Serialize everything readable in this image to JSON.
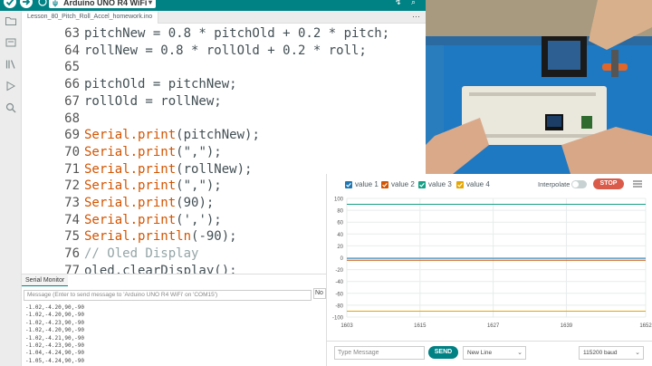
{
  "toolbar": {
    "board_name": "Arduino UNO R4 WiFi",
    "right_icons": [
      "plotter-icon",
      "serial-monitor-icon"
    ]
  },
  "tabs": [
    {
      "label": "Lesson_80_Pitch_Roll_Accel_homework.ino"
    }
  ],
  "editor": {
    "lines": [
      {
        "num": "63",
        "text": "pitchNew = 0.8 * pitchOld + 0.2 * pitch;"
      },
      {
        "num": "64",
        "text": "rollNew = 0.8 * rollOld + 0.2 * roll;"
      },
      {
        "num": "65",
        "text": ""
      },
      {
        "num": "66",
        "text": "pitchOld = pitchNew;"
      },
      {
        "num": "67",
        "text": "rollOld = rollNew;"
      },
      {
        "num": "68",
        "text": ""
      },
      {
        "num": "69",
        "kw": "Serial.print",
        "rest": "(pitchNew);"
      },
      {
        "num": "70",
        "kw": "Serial.print",
        "rest": "(\",\");"
      },
      {
        "num": "71",
        "kw": "Serial.print",
        "rest": "(rollNew);"
      },
      {
        "num": "72",
        "kw": "Serial.print",
        "rest": "(\",\");"
      },
      {
        "num": "73",
        "kw": "Serial.print",
        "rest": "(90);"
      },
      {
        "num": "74",
        "kw": "Serial.print",
        "rest": "(',');"
      },
      {
        "num": "75",
        "kw": "Serial.println",
        "rest": "(-90);"
      },
      {
        "num": "76",
        "comment": "// Oled Display"
      },
      {
        "num": "77",
        "text": "oled.clearDisplay();"
      }
    ]
  },
  "serial_monitor": {
    "tab_label": "Serial Monitor",
    "input_placeholder": "Message (Enter to send message to 'Arduino UNO R4 WiFi' on 'COM15')",
    "right_button": "No",
    "lines": [
      "-1.02,-4.20,90,-90",
      "-1.02,-4.20,90,-90",
      "-1.02,-4.23,90,-90",
      "-1.02,-4.20,90,-90",
      "-1.02,-4.21,90,-90",
      "-1.02,-4.23,90,-90",
      "-1.04,-4.24,90,-90",
      "-1.05,-4.24,90,-90"
    ]
  },
  "plotter": {
    "legend": [
      {
        "label": "value 1",
        "color": "#1f77b4"
      },
      {
        "label": "value 2",
        "color": "#d35400"
      },
      {
        "label": "value 3",
        "color": "#16a085"
      },
      {
        "label": "value 4",
        "color": "#e6a700"
      }
    ],
    "interpolate_label": "Interpolate",
    "stop_label": "STOP",
    "message_placeholder": "Type Message",
    "send_label": "SEND",
    "line_ending": "New Line",
    "baud": "115200 baud"
  },
  "chart_data": {
    "type": "line",
    "y_ticks": [
      100,
      80,
      60,
      40,
      20,
      0,
      -20,
      -40,
      -60,
      -80,
      -100
    ],
    "x_ticks": [
      1603,
      1615,
      1627,
      1639,
      1652
    ],
    "ylim": [
      -100,
      100
    ],
    "xlim": [
      1603,
      1652
    ],
    "grid": true,
    "series": [
      {
        "name": "value 1",
        "color": "#1f77b4",
        "values": [
          -1.0,
          -1.0
        ]
      },
      {
        "name": "value 2",
        "color": "#d35400",
        "values": [
          -4.2,
          -4.2
        ]
      },
      {
        "name": "value 3",
        "color": "#16a085",
        "values": [
          90,
          90
        ]
      },
      {
        "name": "value 4",
        "color": "#e6a700",
        "values": [
          -90,
          -90
        ]
      }
    ]
  }
}
